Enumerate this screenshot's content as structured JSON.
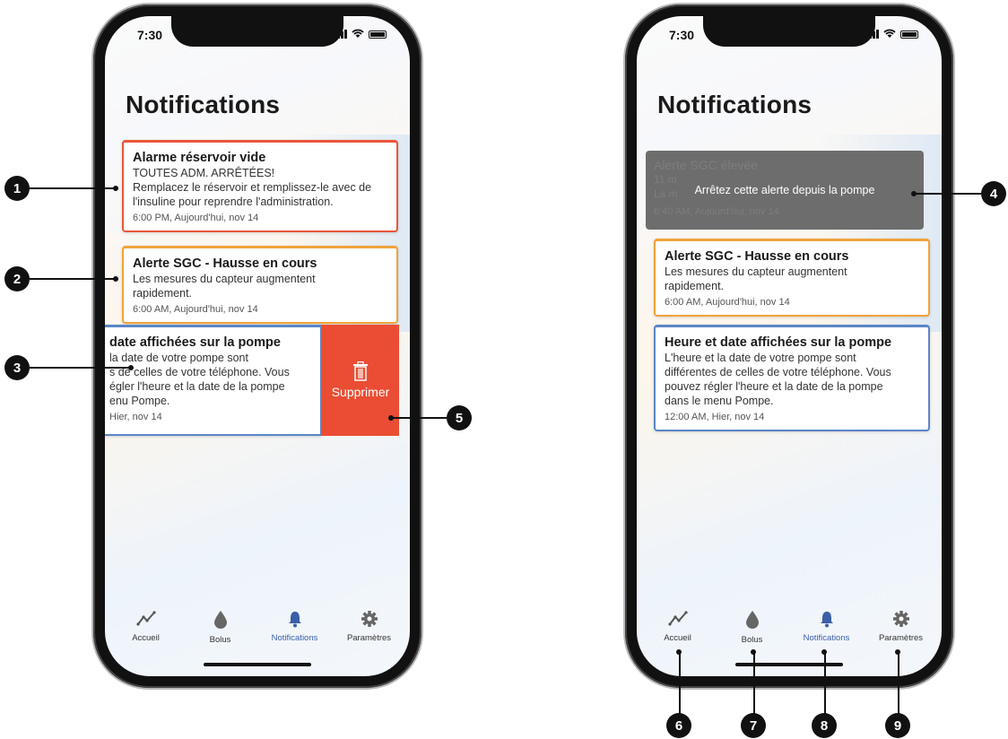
{
  "status_bar": {
    "time": "7:30"
  },
  "page_title": "Notifications",
  "left_phone": {
    "cards": [
      {
        "title": "Alarme réservoir vide",
        "lines": [
          "TOUTES ADM. ARRÊTÉES!",
          "Remplacez le réservoir et remplissez-le avec de",
          "l'insuline pour reprendre l'administration."
        ],
        "date": "6:00 PM, Aujourd'hui, nov 14"
      },
      {
        "title": "Alerte SGC - Hausse en cours",
        "lines": [
          "Les mesures du capteur augmentent",
          "rapidement."
        ],
        "date": "6:00 AM, Aujourd'hui, nov 14"
      }
    ],
    "swiped_card": {
      "title": "date affichées sur la pompe",
      "lines": [
        "la date de votre pompe sont",
        "s de celles de votre téléphone. Vous",
        "égler l'heure et la date de la pompe",
        "enu Pompe."
      ],
      "date": "Hier, nov 14"
    },
    "delete_label": "Supprimer"
  },
  "right_phone": {
    "overlay": {
      "message": "Arrêtez cette alerte depuis la pompe",
      "ghost_title": "Alerte SGC élevée",
      "ghost_line1": "11 m",
      "ghost_line2": "La m",
      "ghost_date": "6:40 AM, Aujourd'hui, nov 14"
    },
    "cards": [
      {
        "title": "Alerte SGC - Hausse en cours",
        "lines": [
          "Les mesures du capteur augmentent",
          "rapidement."
        ],
        "date": "6:00 AM, Aujourd'hui, nov 14"
      },
      {
        "title": "Heure et date affichées sur la pompe",
        "lines": [
          "L'heure et la date de votre pompe sont",
          "différentes de celles de votre téléphone. Vous",
          "pouvez régler l'heure et la date de la pompe",
          "dans le menu Pompe."
        ],
        "date": "12:00 AM, Hier, nov 14"
      }
    ]
  },
  "tabs": [
    {
      "label": "Accueil",
      "icon": "trend-icon"
    },
    {
      "label": "Bolus",
      "icon": "drop-icon"
    },
    {
      "label": "Notifications",
      "icon": "bell-icon",
      "active": true
    },
    {
      "label": "Paramètres",
      "icon": "gear-icon"
    }
  ],
  "callouts": [
    "1",
    "2",
    "3",
    "4",
    "5",
    "6",
    "7",
    "8",
    "9"
  ],
  "colors": {
    "alarm": "#e9573b",
    "alert": "#f0a33b",
    "info": "#5b86c6",
    "delete": "#ea4d33",
    "active_tab": "#3a5fa8"
  }
}
